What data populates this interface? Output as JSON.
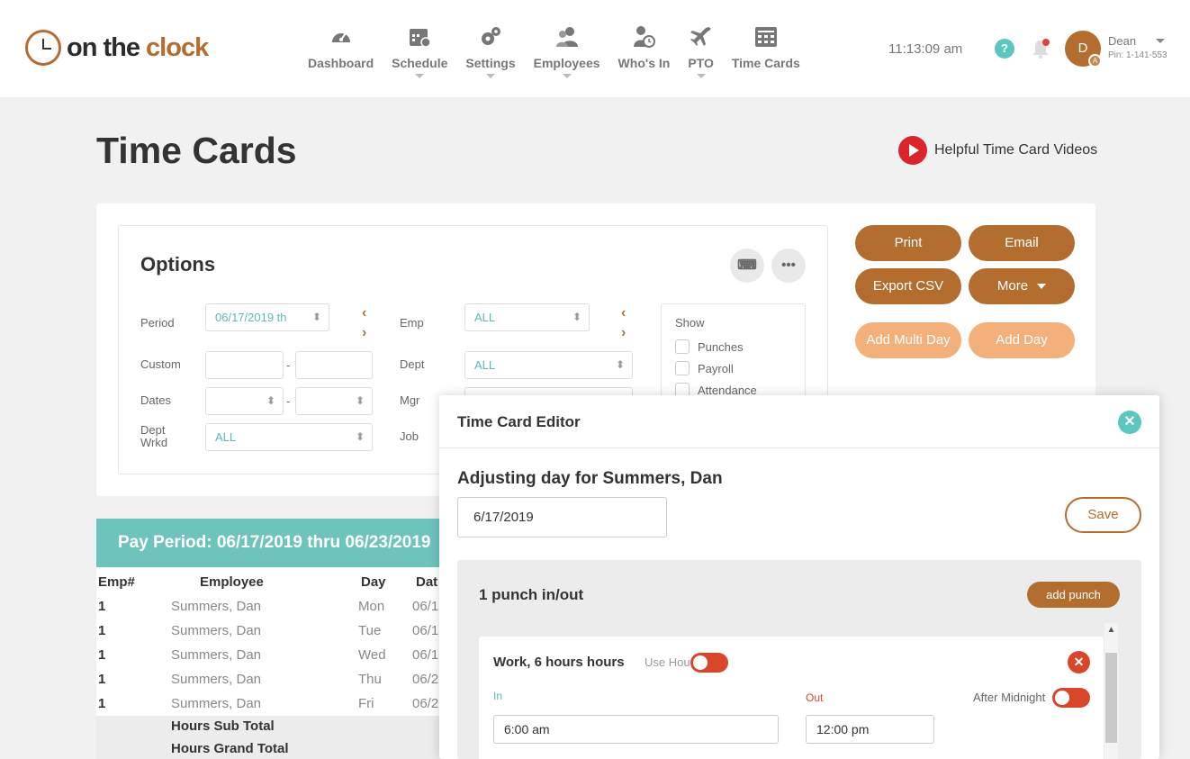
{
  "brand": {
    "name_part1": "on the ",
    "name_part2": "clock"
  },
  "nav": [
    {
      "label": "Dashboard",
      "icon": "dashboard-icon",
      "caret": false
    },
    {
      "label": "Schedule",
      "icon": "calendar-icon",
      "caret": true
    },
    {
      "label": "Settings",
      "icon": "gears-icon",
      "caret": true
    },
    {
      "label": "Employees",
      "icon": "users-icon",
      "caret": true
    },
    {
      "label": "Who's In",
      "icon": "user-clock-icon",
      "caret": false
    },
    {
      "label": "PTO",
      "icon": "plane-icon",
      "caret": true
    },
    {
      "label": "Time Cards",
      "icon": "timecard-icon",
      "caret": false
    }
  ],
  "header": {
    "time": "11:13:09 am",
    "help": "?",
    "user": {
      "initial": "D",
      "badge": "A",
      "name": "Dean",
      "pin": "Pin: 1-141-553"
    }
  },
  "page": {
    "title": "Time Cards",
    "video_link": "Helpful Time Card Videos"
  },
  "options": {
    "title": "Options",
    "period": {
      "label": "Period",
      "value": "06/17/2019 th"
    },
    "custom": {
      "label": "Custom"
    },
    "dates": {
      "label": "Dates"
    },
    "dept_wrkd": {
      "label": "Dept Wrkd",
      "value": "ALL"
    },
    "emp": {
      "label": "Emp",
      "value": "ALL"
    },
    "dept": {
      "label": "Dept",
      "value": "ALL"
    },
    "mgr": {
      "label": "Mgr"
    },
    "job": {
      "label": "Job"
    },
    "show": {
      "title": "Show",
      "items": [
        "Punches",
        "Payroll",
        "Attendance"
      ]
    }
  },
  "actions": {
    "print": "Print",
    "email": "Email",
    "export_csv": "Export CSV",
    "more": "More",
    "add_multi_day": "Add Multi Day",
    "add_day": "Add Day"
  },
  "pay_period": {
    "title": "Pay Period: 06/17/2019 thru 06/23/2019",
    "columns": [
      "Emp#",
      "Employee",
      "Day",
      "Dat"
    ],
    "rows": [
      {
        "emp": "1",
        "employee": "Summers, Dan",
        "day": "Mon",
        "date": "06/1"
      },
      {
        "emp": "1",
        "employee": "Summers, Dan",
        "day": "Tue",
        "date": "06/1"
      },
      {
        "emp": "1",
        "employee": "Summers, Dan",
        "day": "Wed",
        "date": "06/1"
      },
      {
        "emp": "1",
        "employee": "Summers, Dan",
        "day": "Thu",
        "date": "06/2"
      },
      {
        "emp": "1",
        "employee": "Summers, Dan",
        "day": "Fri",
        "date": "06/2"
      }
    ],
    "sub_total": "Hours Sub Total",
    "grand_total": "Hours Grand Total"
  },
  "editor": {
    "title": "Time Card Editor",
    "adjusting": "Adjusting day for Summers, Dan",
    "date": "6/17/2019",
    "save": "Save",
    "punch_count": "1 punch in/out",
    "add_punch": "add punch",
    "punch": {
      "title": "Work, 6 hours hours",
      "use_hours": "Use Hours",
      "in_label": "In",
      "out_label": "Out",
      "after_midnight": "After Midnight",
      "in_value": "6:00 am",
      "out_value": "12:00 pm"
    }
  },
  "colors": {
    "brand": "#b36d2f",
    "teal": "#6ec4bd",
    "red": "#d9472b",
    "light_orange": "#f4b07a"
  }
}
